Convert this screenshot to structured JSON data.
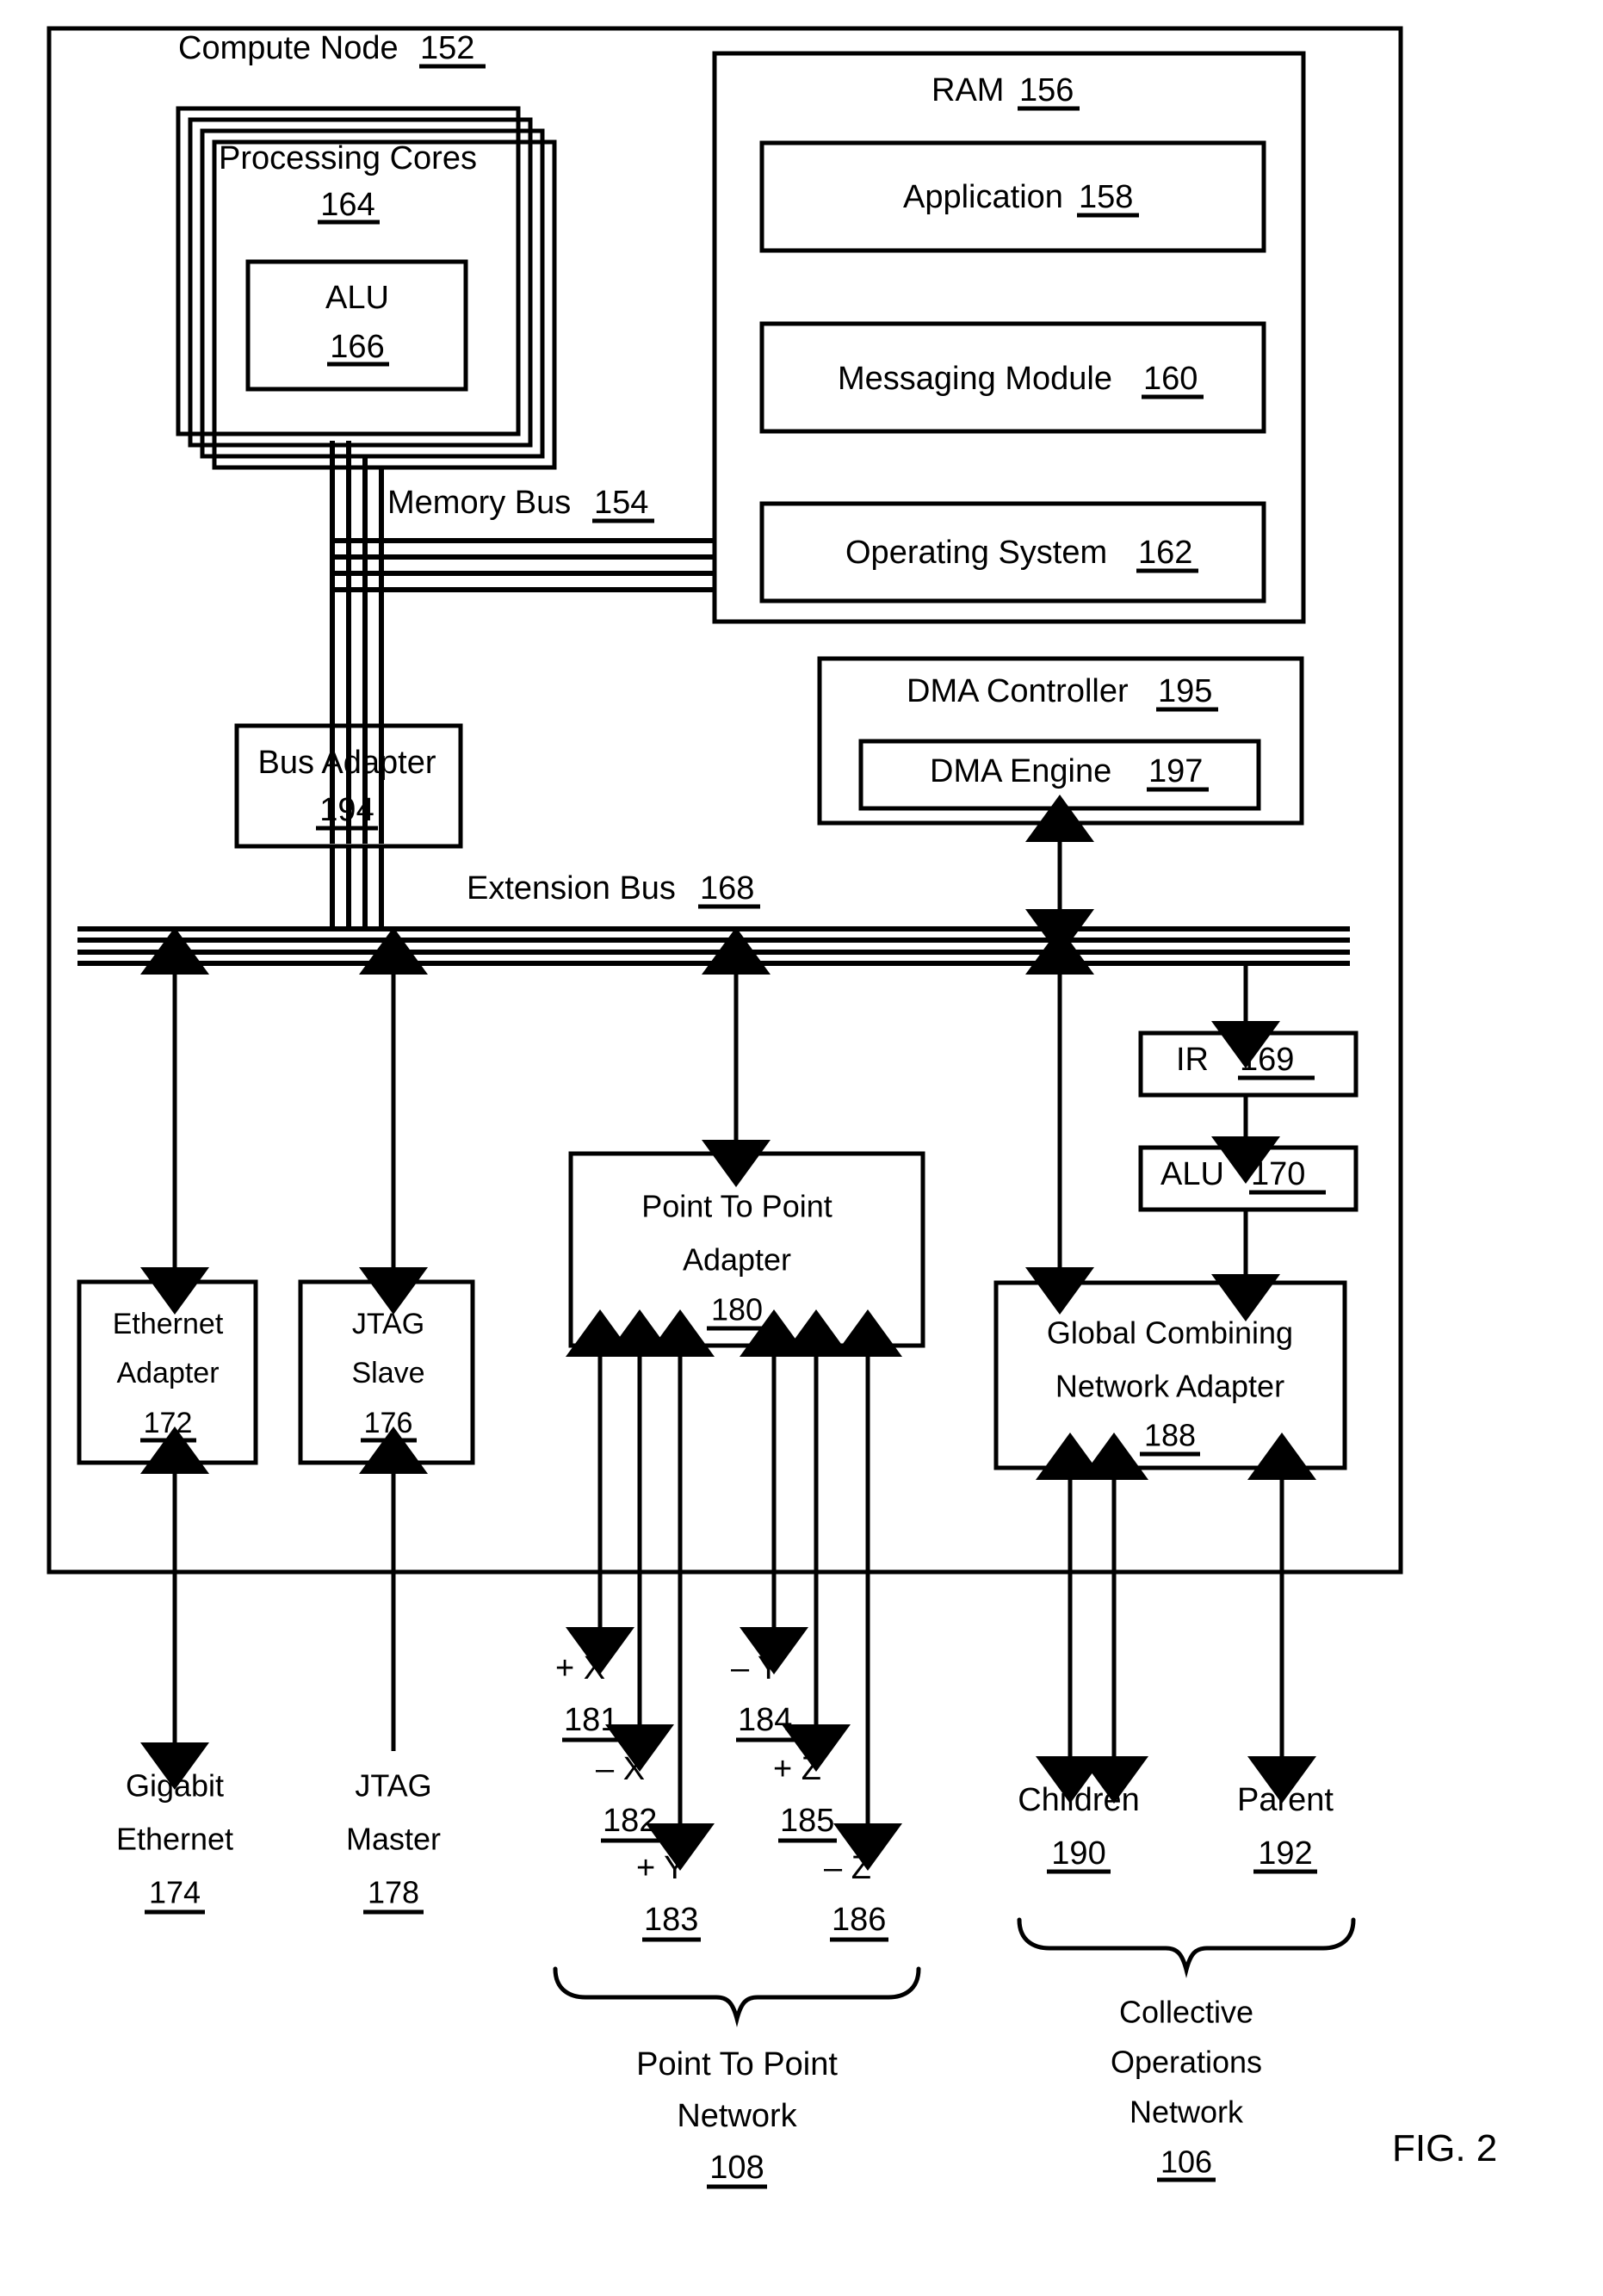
{
  "figure": {
    "caption": "FIG. 2"
  },
  "outer": {
    "title_text": "Compute Node",
    "title_ref": "152"
  },
  "ram": {
    "title_text": "RAM",
    "title_ref": "156",
    "items": [
      {
        "text": "Application",
        "ref": "158"
      },
      {
        "text": "Messaging Module",
        "ref": "160"
      },
      {
        "text": "Operating System",
        "ref": "162"
      }
    ]
  },
  "cores": {
    "line1": "Processing Cores",
    "ref": "164",
    "alu": {
      "text": "ALU",
      "ref": "166"
    }
  },
  "buses": {
    "memory_bus": {
      "text": "Memory Bus",
      "ref": "154"
    },
    "extension_bus": {
      "text": "Extension Bus",
      "ref": "168"
    }
  },
  "bus_adapter": {
    "line1": "Bus Adapter",
    "ref": "194"
  },
  "dma": {
    "controller": {
      "text": "DMA Controller",
      "ref": "195"
    },
    "engine": {
      "text": "DMA Engine",
      "ref": "197"
    }
  },
  "ir": {
    "text": "IR",
    "ref": "169"
  },
  "alu_right": {
    "text": "ALU",
    "ref": "170"
  },
  "adapters": {
    "ethernet": {
      "line1": "Ethernet",
      "line2": "Adapter",
      "ref": "172"
    },
    "jtag_slave": {
      "line1": "JTAG",
      "line2": "Slave",
      "ref": "176"
    },
    "point_to_point": {
      "line1": "Point To Point",
      "line2": "Adapter",
      "ref": "180"
    },
    "global_combining": {
      "line1": "Global Combining",
      "line2": "Network Adapter",
      "ref": "188"
    }
  },
  "endpoints": {
    "gigabit_ethernet": {
      "line1": "Gigabit",
      "line2": "Ethernet",
      "ref": "174"
    },
    "jtag_master": {
      "line1": "JTAG",
      "line2": "Master",
      "ref": "178"
    },
    "children": {
      "text": "Children",
      "ref": "190"
    },
    "parent": {
      "text": "Parent",
      "ref": "192"
    }
  },
  "torus_links": [
    {
      "axis": "+ X",
      "ref": "181"
    },
    {
      "axis": "– X",
      "ref": "182"
    },
    {
      "axis": "+ Y",
      "ref": "183"
    },
    {
      "axis": "– Y",
      "ref": "184"
    },
    {
      "axis": "+ Z",
      "ref": "185"
    },
    {
      "axis": "– Z",
      "ref": "186"
    }
  ],
  "networks": {
    "point_to_point": {
      "line1": "Point To Point",
      "line2": "Network",
      "ref": "108"
    },
    "collective": {
      "line1": "Collective",
      "line2": "Operations",
      "line3": "Network",
      "ref": "106"
    }
  },
  "colors": {
    "stroke": "#000000",
    "background": "#ffffff"
  }
}
